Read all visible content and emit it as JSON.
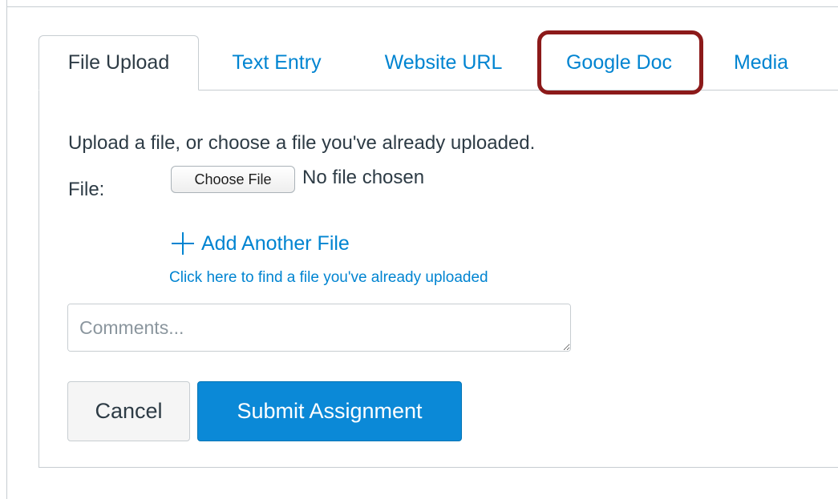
{
  "tabs": [
    {
      "label": "File Upload",
      "active": true
    },
    {
      "label": "Text Entry",
      "active": false
    },
    {
      "label": "Website URL",
      "active": false
    },
    {
      "label": "Google Doc",
      "active": false,
      "highlighted": true
    },
    {
      "label": "Media",
      "active": false
    }
  ],
  "upload": {
    "instructions": "Upload a file, or choose a file you've already uploaded.",
    "file_label": "File:",
    "choose_button": "Choose File",
    "file_status": "No file chosen",
    "add_another": "Add Another File",
    "find_uploaded": "Click here to find a file you've already uploaded"
  },
  "comments": {
    "placeholder": "Comments...",
    "value": ""
  },
  "actions": {
    "cancel": "Cancel",
    "submit": "Submit Assignment"
  },
  "colors": {
    "link": "#0084d1",
    "primary_button": "#0b89d7",
    "highlight_outline": "#8c1a1a",
    "border": "#c7cdd1",
    "text": "#2d3b45"
  },
  "icons": {
    "add": "plus-icon"
  }
}
